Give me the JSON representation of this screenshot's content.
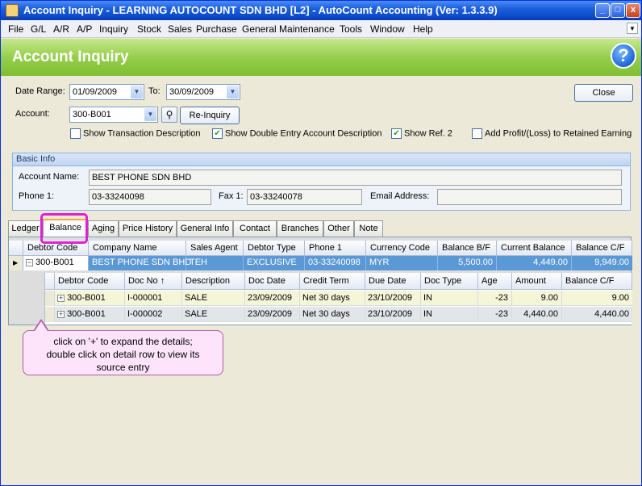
{
  "window": {
    "title": "Account Inquiry - LEARNING AUTOCOUNT SDN BHD [L2] - AutoCount Accounting (Ver: 1.3.3.9)",
    "controls": {
      "minimize": "_",
      "maximize": "□",
      "close": "x"
    }
  },
  "menu": [
    "File",
    "G/L",
    "A/R",
    "A/P",
    "Inquiry",
    "Stock",
    "Sales",
    "Purchase",
    "General Maintenance",
    "Tools",
    "Window",
    "Help"
  ],
  "header": {
    "title": "Account Inquiry",
    "help_symbol": "?"
  },
  "filters": {
    "date_range_label": "Date Range:",
    "date_from": "01/09/2009",
    "to_label": "To:",
    "date_to": "30/09/2009",
    "account_label": "Account:",
    "account": "300-B001",
    "reinquiry_label": "Re-Inquiry",
    "close_label": "Close"
  },
  "options": [
    {
      "label": "Show Transaction Description",
      "checked": false
    },
    {
      "label": "Show Double Entry Account Description",
      "checked": true
    },
    {
      "label": "Show Ref. 2",
      "checked": true
    },
    {
      "label": "Add Profit/(Loss) to Retained Earning",
      "checked": false
    }
  ],
  "basic_info": {
    "title": "Basic Info",
    "account_name_label": "Account Name:",
    "account_name": "BEST PHONE SDN BHD",
    "phone1_label": "Phone 1:",
    "phone1": "03-33240098",
    "fax1_label": "Fax 1:",
    "fax1": "03-33240078",
    "email_label": "Email Address:",
    "email": ""
  },
  "tabs": [
    "Ledger",
    "Balance",
    "Aging",
    "Price History",
    "General Info",
    "Contact",
    "Branches",
    "Other",
    "Note"
  ],
  "active_tab": "Balance",
  "grid": {
    "columns": [
      "Debtor Code",
      "Company Name",
      "Sales Agent",
      "Debtor Type",
      "Phone 1",
      "Currency Code",
      "Balance B/F",
      "Current Balance",
      "Balance C/F"
    ],
    "row": [
      "300-B001",
      "BEST PHONE SDN BHD",
      "TEH",
      "EXCLUSIVE",
      "03-33240098",
      "MYR",
      "5,500.00",
      "4,449.00",
      "9,949.00"
    ],
    "detail_columns": [
      "Debtor Code",
      "Doc No",
      "Description",
      "Doc Date",
      "Credit Term",
      "Due Date",
      "Doc Type",
      "Age",
      "Amount",
      "Balance C/F"
    ],
    "detail_rows": [
      [
        "300-B001",
        "I-000001",
        "SALE",
        "23/09/2009",
        "Net 30 days",
        "23/10/2009",
        "IN",
        "-23",
        "9.00",
        "9.00"
      ],
      [
        "300-B001",
        "I-000002",
        "SALE",
        "23/09/2009",
        "Net 30 days",
        "23/10/2009",
        "IN",
        "-23",
        "4,440.00",
        "4,440.00"
      ]
    ]
  },
  "callout": {
    "line1": "click on '+' to expand the details;",
    "line2": "double click on detail row to view its",
    "line3": "source entry"
  }
}
